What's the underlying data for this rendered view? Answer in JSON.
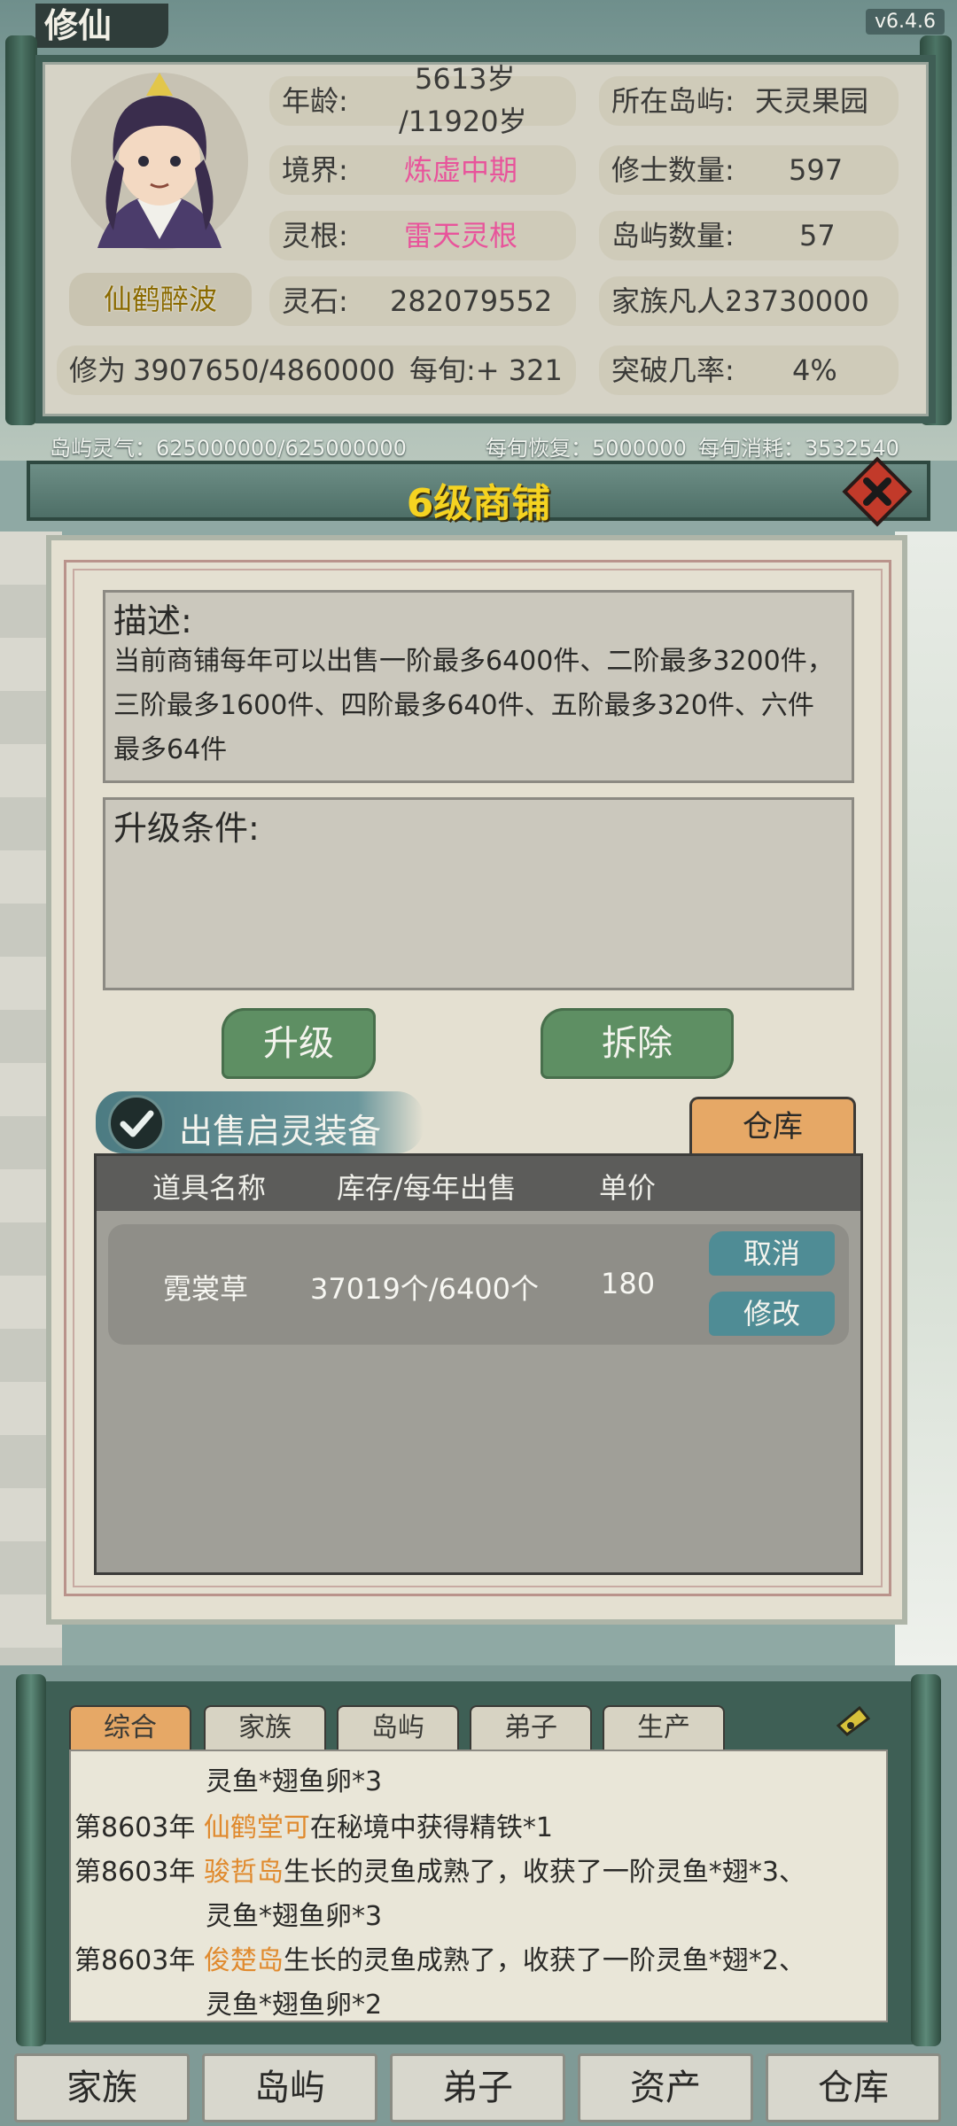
{
  "app": {
    "logo": "修仙",
    "version": "v6.4.6"
  },
  "character": {
    "name": "仙鹤醉波",
    "age_label": "年龄:",
    "age_value": "5613岁",
    "age_max": "/11920岁",
    "realm_label": "境界:",
    "realm_value": "炼虚中期",
    "root_label": "灵根:",
    "root_value": "雷天灵根",
    "stones_label": "灵石:",
    "stones_value": "282079552",
    "cultivation_label": "修为",
    "cultivation_value": "3907650/4860000",
    "per_turn_label": "每旬",
    "per_turn_value": ":+ 321"
  },
  "island": {
    "location_label": "所在岛屿:",
    "location_value": "天灵果园",
    "cultivators_label": "修士数量:",
    "cultivators_value": "597",
    "islands_label": "岛屿数量:",
    "islands_value": "57",
    "mortals_label": "家族凡人:",
    "mortals_value": "23730000",
    "breakthrough_label": "突破几率:",
    "breakthrough_value": "4%"
  },
  "aura": {
    "island_qi": "岛屿灵气：625000000/625000000",
    "recovery": "每旬恢复：5000000",
    "consumption": "每旬消耗：3532540"
  },
  "shop": {
    "title": "6级商铺",
    "desc_title": "描述:",
    "desc_text": "当前商铺每年可以出售一阶最多6400件、二阶最多3200件，三阶最多1600件、四阶最多640件、五阶最多320件、六件最多64件",
    "req_title": "升级条件:",
    "upgrade_label": "升级",
    "demolish_label": "拆除",
    "sell_toggle_label": "出售启灵装备",
    "warehouse_tab": "仓库",
    "columns": [
      "道具名称",
      "库存/每年出售",
      "单价"
    ],
    "rows": [
      {
        "name": "霓裳草",
        "stock": "37019个/6400个",
        "price": "180",
        "cancel": "取消",
        "edit": "修改"
      }
    ]
  },
  "log": {
    "tabs": [
      "综合",
      "家族",
      "岛屿",
      "弟子",
      "生产"
    ],
    "entries": [
      {
        "year": "",
        "actor": "",
        "text": "灵鱼*翅鱼卵*3"
      },
      {
        "year": "第8603年",
        "actor": "仙鹤堂可",
        "text": "在秘境中获得精铁*1"
      },
      {
        "year": "第8603年",
        "actor": "骏哲岛",
        "text": "生长的灵鱼成熟了，收获了一阶灵鱼*翅*3、"
      },
      {
        "year": "",
        "actor": "",
        "text": "灵鱼*翅鱼卵*3"
      },
      {
        "year": "第8603年",
        "actor": "俊楚岛",
        "text": "生长的灵鱼成熟了，收获了一阶灵鱼*翅*2、"
      },
      {
        "year": "",
        "actor": "",
        "text": "灵鱼*翅鱼卵*2"
      }
    ]
  },
  "nav": [
    "家族",
    "岛屿",
    "弟子",
    "资产",
    "仓库"
  ],
  "colors": {
    "realm": "#e8549b",
    "title": "#f5d321",
    "highlight": "#e08a2e",
    "button_green": "#5e8f63",
    "button_teal": "#4f8c95"
  }
}
